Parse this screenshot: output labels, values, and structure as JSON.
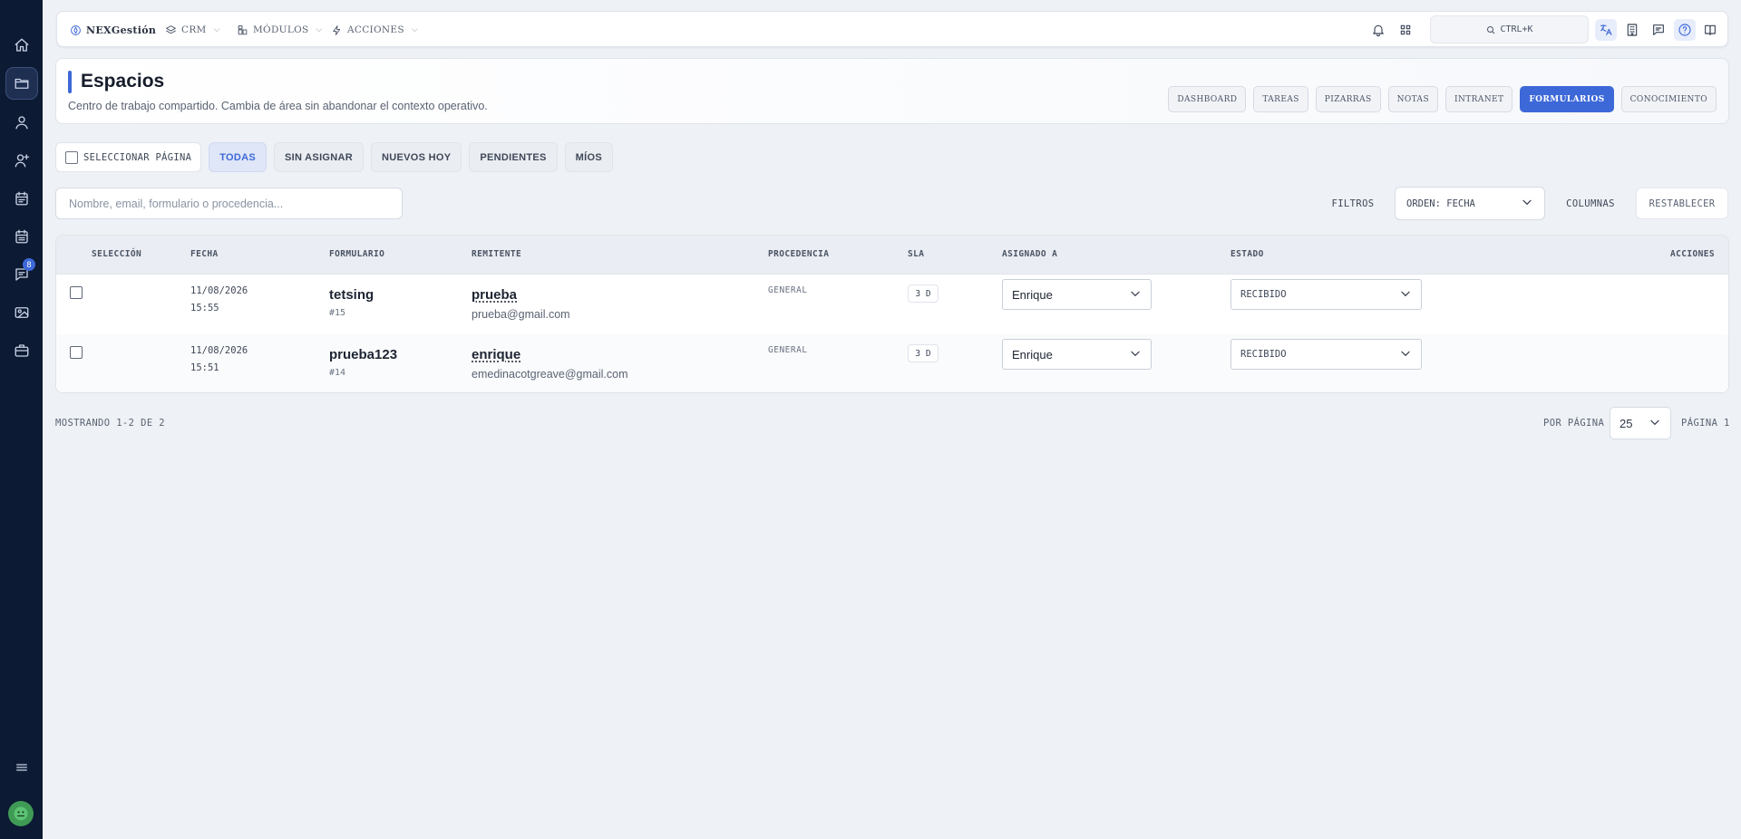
{
  "sidebar": {
    "items": [
      {
        "icon": "home-icon"
      },
      {
        "icon": "folder-icon",
        "active": true
      },
      {
        "icon": "user-icon"
      },
      {
        "icon": "user-plus-icon"
      },
      {
        "icon": "calendar-icon"
      },
      {
        "icon": "calendar-list-icon"
      },
      {
        "icon": "chat-icon",
        "badge": "8"
      },
      {
        "icon": "image-icon"
      },
      {
        "icon": "briefcase-icon"
      }
    ],
    "menu_icon": "menu-icon",
    "avatar_icon": "avatar-icon"
  },
  "topbar": {
    "brand": "NEXGestión",
    "crm": "CRM",
    "modulos": "MÓDULOS",
    "acciones": "ACCIONES",
    "search_shortcut": "CTRL+K"
  },
  "header": {
    "title": "Espacios",
    "subtitle": "Centro de trabajo compartido. Cambia de área sin abandonar el contexto operativo.",
    "tabs": [
      "DASHBOARD",
      "TAREAS",
      "PIZARRAS",
      "NOTAS",
      "INTRANET",
      "FORMULARIOS",
      "CONOCIMIENTO"
    ],
    "active_tab": "FORMULARIOS"
  },
  "filters": {
    "select_page": "SELECCIONAR PÁGINA",
    "chips": [
      "TODAS",
      "SIN ASIGNAR",
      "NUEVOS HOY",
      "PENDIENTES",
      "MÍOS"
    ],
    "active_chip": "TODAS"
  },
  "toolbar": {
    "search_placeholder": "Nombre, email, formulario o procedencia...",
    "filtros": "FILTROS",
    "order": "ORDEN: FECHA",
    "columnas": "COLUMNAS",
    "reset": "RESTABLECER"
  },
  "table": {
    "columns": {
      "seleccion": "SELECCIÓN",
      "fecha": "FECHA",
      "formulario": "FORMULARIO",
      "remitente": "REMITENTE",
      "procedencia": "PROCEDENCIA",
      "sla": "SLA",
      "asignado": "ASIGNADO A",
      "estado": "ESTADO",
      "acciones": "ACCIONES"
    },
    "rows": [
      {
        "date": "11/08/2026",
        "time": "15:55",
        "form": "tetsing",
        "form_id": "#15",
        "sender": "prueba",
        "email": "prueba@gmail.com",
        "origin": "GENERAL",
        "sla": "3 D",
        "assignee": "Enrique",
        "status": "RECIBIDO"
      },
      {
        "date": "11/08/2026",
        "time": "15:51",
        "form": "prueba123",
        "form_id": "#14",
        "sender": "enrique",
        "email": "emedinacotgreave@gmail.com",
        "origin": "GENERAL",
        "sla": "3 D",
        "assignee": "Enrique",
        "status": "RECIBIDO"
      }
    ]
  },
  "footer": {
    "showing": "MOSTRANDO 1-2 DE 2",
    "per_page_label": "POR PÁGINA",
    "per_page_value": "25",
    "page_label": "PÁGINA 1"
  },
  "colors": {
    "accent": "#3d68d8",
    "sidebar": "#0d1a33",
    "background": "#eef1f5"
  }
}
